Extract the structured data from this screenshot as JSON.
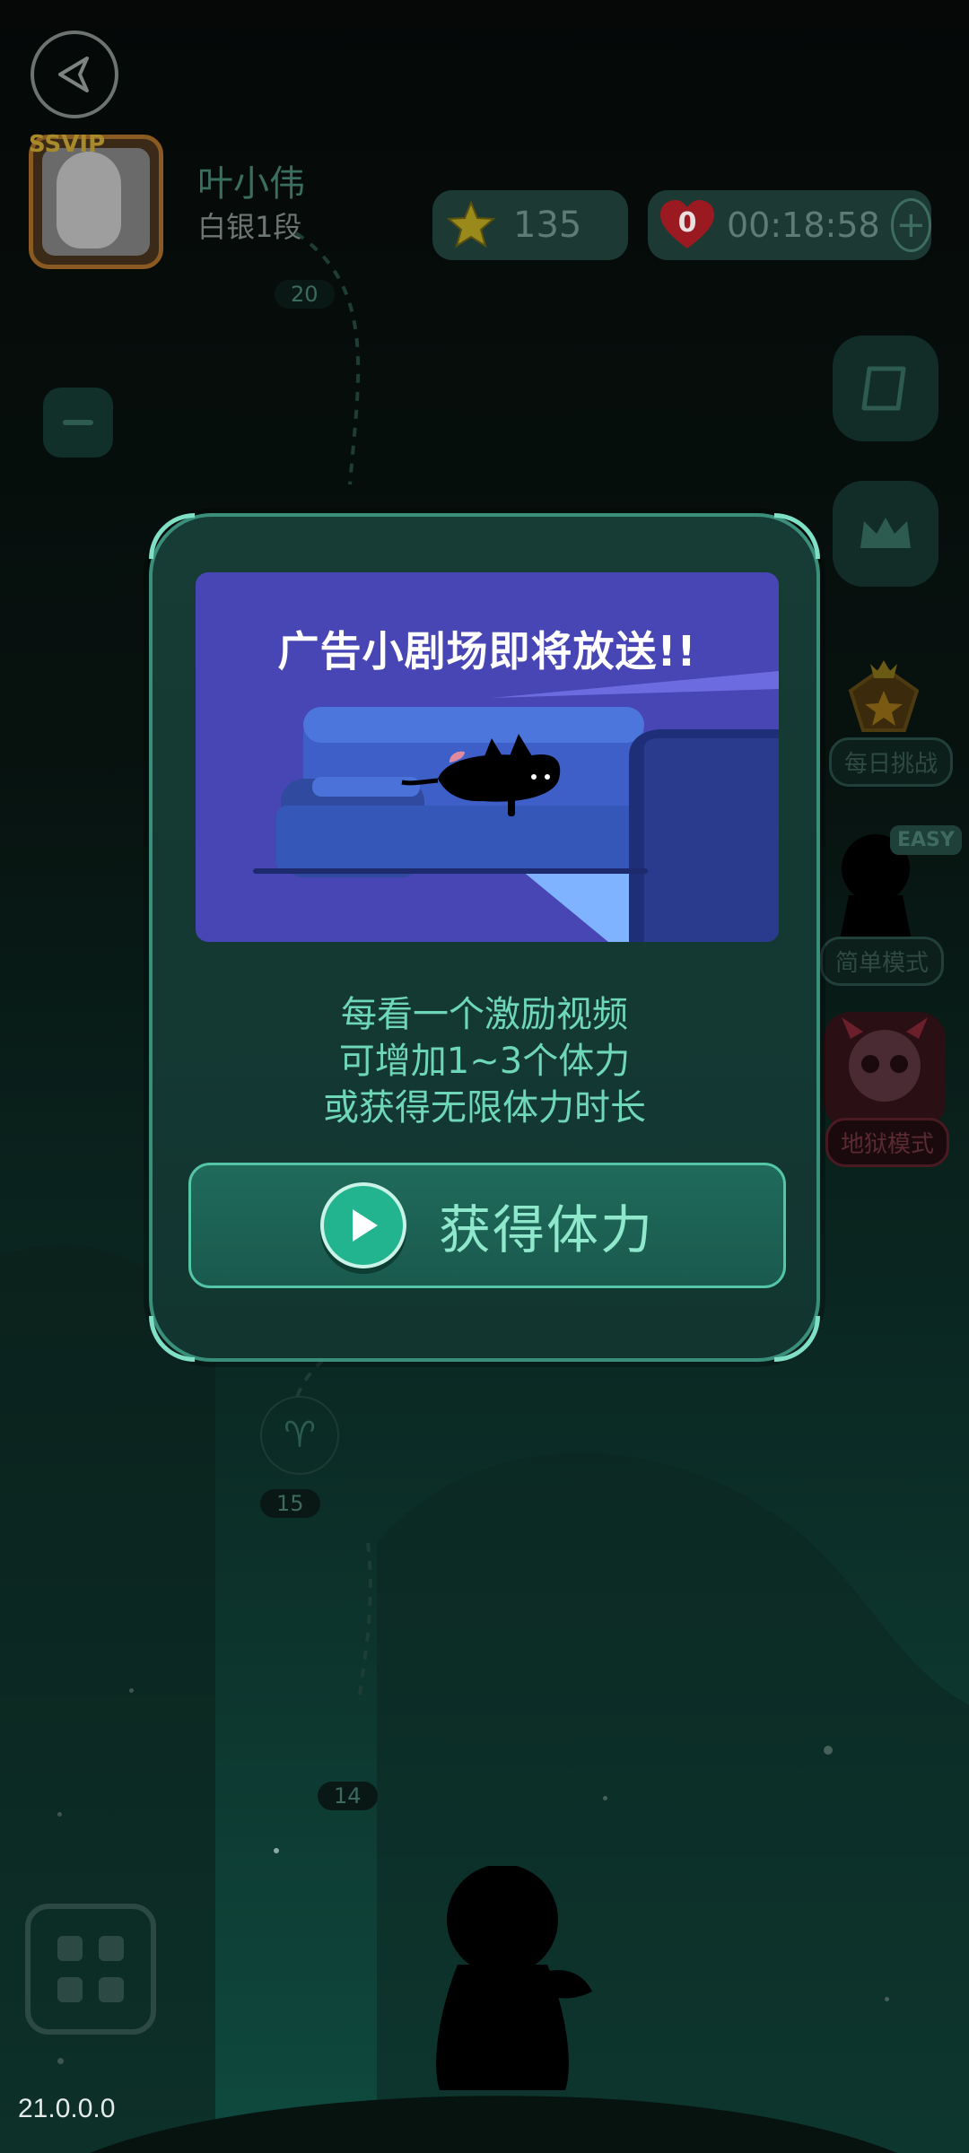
{
  "header": {
    "back_icon": "back-triangle-icon",
    "vip_label": "SSVIP",
    "user_name": "叶小伟",
    "user_rank": "白银1段",
    "stars": "135",
    "lives": "0",
    "timer": "00:18:58",
    "plus_label": "+"
  },
  "side_menu": {
    "daily_challenge_label": "每日挑战",
    "easy_mode_label": "简单模式",
    "easy_badge": "EASY",
    "hell_mode_label": "地狱模式"
  },
  "map": {
    "levels": [
      {
        "num": "20"
      },
      {
        "num": "15"
      },
      {
        "num": "15"
      },
      {
        "num": "14"
      }
    ]
  },
  "modal": {
    "ad_title": "广告小剧场即将放送!!",
    "line1": "每看一个激励视频",
    "line2": "可增加1~3个体力",
    "line3": "或获得无限体力时长",
    "button_label": "获得体力"
  },
  "footer": {
    "version": "21.0.0.0"
  },
  "colors": {
    "accent": "#54c5a7",
    "modal_bg": "#163c35",
    "ad_bg": "#4846b4"
  }
}
